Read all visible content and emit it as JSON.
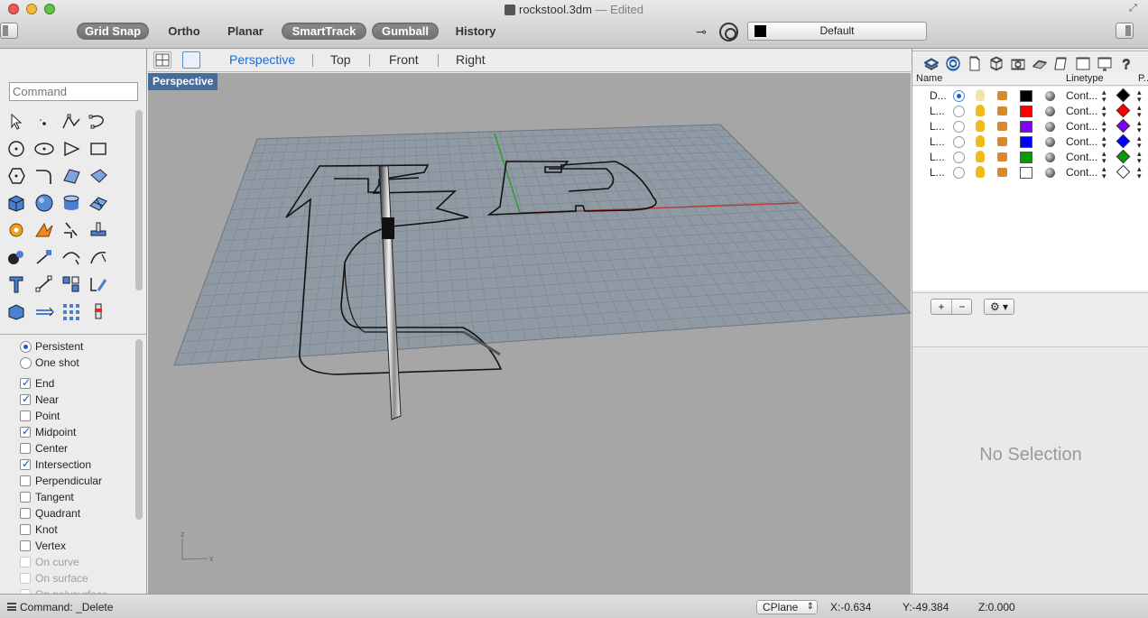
{
  "window": {
    "title": "rockstool.3dm",
    "edited_suffix": "— Edited"
  },
  "toolbar": {
    "buttons": [
      {
        "label": "Grid Snap",
        "active": true
      },
      {
        "label": "Ortho",
        "active": false
      },
      {
        "label": "Planar",
        "active": false
      },
      {
        "label": "SmartTrack",
        "active": true
      },
      {
        "label": "Gumball",
        "active": true
      },
      {
        "label": "History",
        "active": false
      }
    ],
    "current_layer": "Default",
    "current_layer_color": "#000000"
  },
  "viewport_tabs": [
    "Perspective",
    "Top",
    "Front",
    "Right"
  ],
  "active_viewport": "Perspective",
  "command_input": {
    "placeholder": "Command"
  },
  "osnap": {
    "mode_persistent": "Persistent",
    "mode_oneshot": "One shot",
    "items": [
      {
        "label": "End",
        "checked": true,
        "enabled": true
      },
      {
        "label": "Near",
        "checked": true,
        "enabled": true
      },
      {
        "label": "Point",
        "checked": false,
        "enabled": true
      },
      {
        "label": "Midpoint",
        "checked": true,
        "enabled": true
      },
      {
        "label": "Center",
        "checked": false,
        "enabled": true
      },
      {
        "label": "Intersection",
        "checked": true,
        "enabled": true
      },
      {
        "label": "Perpendicular",
        "checked": false,
        "enabled": true
      },
      {
        "label": "Tangent",
        "checked": false,
        "enabled": true
      },
      {
        "label": "Quadrant",
        "checked": false,
        "enabled": true
      },
      {
        "label": "Knot",
        "checked": false,
        "enabled": true
      },
      {
        "label": "Vertex",
        "checked": false,
        "enabled": true
      },
      {
        "label": "On curve",
        "checked": false,
        "enabled": false
      },
      {
        "label": "On surface",
        "checked": false,
        "enabled": false
      },
      {
        "label": "On polysurface",
        "checked": false,
        "enabled": false
      }
    ]
  },
  "viewport": {
    "label": "Perspective",
    "axis_z": "z",
    "axis_x": "x"
  },
  "layers": {
    "header_name": "Name",
    "header_linetype": "Linetype",
    "header_print": "P..",
    "rows": [
      {
        "name": "D...",
        "current": true,
        "on": false,
        "locked": false,
        "color": "#000000",
        "linetype": "Cont...",
        "print_color": "#000000"
      },
      {
        "name": "L...",
        "current": false,
        "on": true,
        "locked": false,
        "color": "#ff0000",
        "linetype": "Cont...",
        "print_color": "#ff0000"
      },
      {
        "name": "L...",
        "current": false,
        "on": true,
        "locked": false,
        "color": "#8000ff",
        "linetype": "Cont...",
        "print_color": "#8000ff"
      },
      {
        "name": "L...",
        "current": false,
        "on": true,
        "locked": false,
        "color": "#0000ff",
        "linetype": "Cont...",
        "print_color": "#0000ff"
      },
      {
        "name": "L...",
        "current": false,
        "on": true,
        "locked": false,
        "color": "#00a000",
        "linetype": "Cont...",
        "print_color": "#00a000"
      },
      {
        "name": "L...",
        "current": false,
        "on": true,
        "locked": false,
        "color": "#ffffff",
        "linetype": "Cont...",
        "print_color": "#ffffff"
      }
    ],
    "add_label": "+",
    "remove_label": "−",
    "gear_label": "⚙ ▾"
  },
  "properties": {
    "empty_message": "No Selection"
  },
  "status_bar": {
    "command": "Command: _Delete",
    "cplane": "CPlane",
    "x": "X:-0.634",
    "y": "Y:-49.384",
    "z": "Z:0.000"
  }
}
